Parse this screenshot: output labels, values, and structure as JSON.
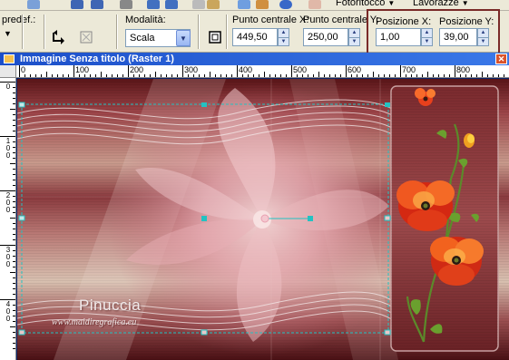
{
  "toolbar": {
    "fotoritocco_label": "Fotoritocco",
    "lavorazze_label": "Lavorazze"
  },
  "options": {
    "preset_label": "predef.:",
    "mode_label": "Modalità:",
    "mode_value": "Scala",
    "center_x_label": "Punto centrale X:",
    "center_x_value": "449,50",
    "center_y_label": "Punto centrale Y:",
    "center_y_value": "250,00",
    "pos_x_label": "Posizione X:",
    "pos_x_value": "1,00",
    "pos_y_label": "Posizione Y:",
    "pos_y_value": "39,00"
  },
  "window": {
    "title": "Immagine Senza titolo (Raster 1)"
  },
  "ruler": {
    "h_labels": [
      "0",
      "100",
      "200",
      "300",
      "400",
      "500",
      "600",
      "700",
      "800"
    ],
    "v_labels": [
      "0",
      "1 0 0",
      "2 0 0",
      "3 0 0",
      "4 0 0"
    ]
  },
  "watermark": {
    "name": "Pinuccia",
    "url": "www.maidiregrafica.eu"
  },
  "colors": {
    "accent": "#7a2a28",
    "selection": "#23c2c2",
    "titlebar": "#2a62d8"
  },
  "icons": [
    "save-icon",
    "undo-icon",
    "redo-icon",
    "crop-icon",
    "info-icon",
    "flip-icon",
    "deform-icon",
    "fullscreen-icon"
  ]
}
